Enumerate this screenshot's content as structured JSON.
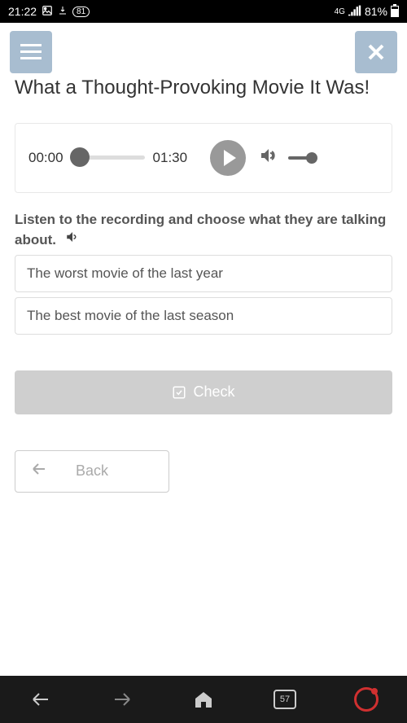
{
  "status": {
    "time": "21:22",
    "network_label": "4G",
    "battery_pct": "81%",
    "download_badge": "81"
  },
  "page": {
    "title": "What a Thought-Provoking Movie It Was!"
  },
  "audio": {
    "current_time": "00:00",
    "total_time": "01:30"
  },
  "question": {
    "instruction": "Listen to the recording and choose what they are talking about.",
    "options": [
      "The worst movie of the last year",
      "The best movie of the last season"
    ]
  },
  "buttons": {
    "check": "Check",
    "back": "Back"
  },
  "nav": {
    "tab_count": "57"
  }
}
